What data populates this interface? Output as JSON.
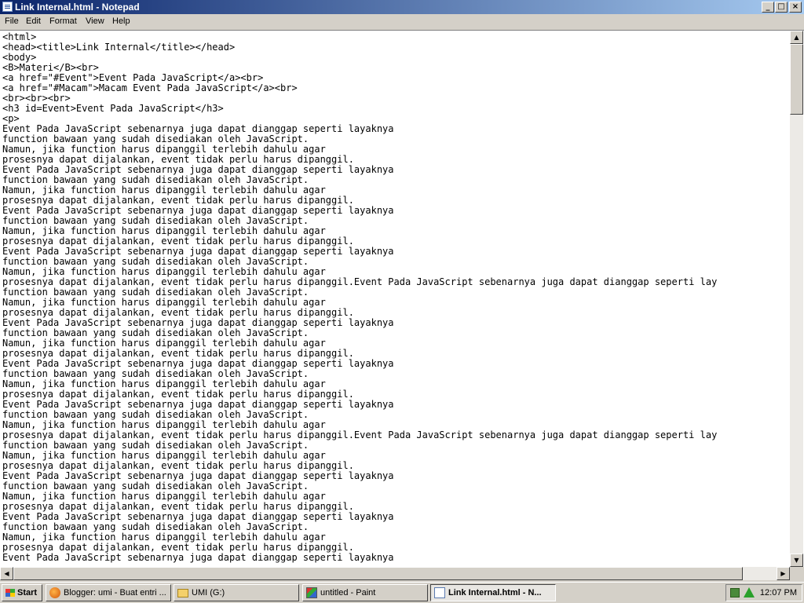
{
  "window": {
    "title": "Link Internal.html - Notepad",
    "controls": {
      "minimize": "_",
      "maximize": "□",
      "close": "×"
    }
  },
  "menu": [
    "File",
    "Edit",
    "Format",
    "View",
    "Help"
  ],
  "editor": {
    "lines": [
      "<html>",
      "<head><title>Link Internal</title></head>",
      "<body>",
      "<B>Materi</B><br>",
      "<a href=\"#Event\">Event Pada JavaScript</a><br>",
      "<a href=\"#Macam\">Macam Event Pada JavaScript</a><br>",
      "<br><br><br>",
      "<h3 id=Event>Event Pada JavaScript</h3>",
      "<p>",
      "Event Pada JavaScript sebenarnya juga dapat dianggap seperti layaknya",
      "function bawaan yang sudah disediakan oleh JavaScript.",
      "Namun, jika function harus dipanggil terlebih dahulu agar",
      "prosesnya dapat dijalankan, event tidak perlu harus dipanggil.",
      "Event Pada JavaScript sebenarnya juga dapat dianggap seperti layaknya",
      "function bawaan yang sudah disediakan oleh JavaScript.",
      "Namun, jika function harus dipanggil terlebih dahulu agar",
      "prosesnya dapat dijalankan, event tidak perlu harus dipanggil.",
      "Event Pada JavaScript sebenarnya juga dapat dianggap seperti layaknya",
      "function bawaan yang sudah disediakan oleh JavaScript.",
      "Namun, jika function harus dipanggil terlebih dahulu agar",
      "prosesnya dapat dijalankan, event tidak perlu harus dipanggil.",
      "Event Pada JavaScript sebenarnya juga dapat dianggap seperti layaknya",
      "function bawaan yang sudah disediakan oleh JavaScript.",
      "Namun, jika function harus dipanggil terlebih dahulu agar",
      "prosesnya dapat dijalankan, event tidak perlu harus dipanggil.Event Pada JavaScript sebenarnya juga dapat dianggap seperti lay",
      "function bawaan yang sudah disediakan oleh JavaScript.",
      "Namun, jika function harus dipanggil terlebih dahulu agar",
      "prosesnya dapat dijalankan, event tidak perlu harus dipanggil.",
      "Event Pada JavaScript sebenarnya juga dapat dianggap seperti layaknya",
      "function bawaan yang sudah disediakan oleh JavaScript.",
      "Namun, jika function harus dipanggil terlebih dahulu agar",
      "prosesnya dapat dijalankan, event tidak perlu harus dipanggil.",
      "Event Pada JavaScript sebenarnya juga dapat dianggap seperti layaknya",
      "function bawaan yang sudah disediakan oleh JavaScript.",
      "Namun, jika function harus dipanggil terlebih dahulu agar",
      "prosesnya dapat dijalankan, event tidak perlu harus dipanggil.",
      "Event Pada JavaScript sebenarnya juga dapat dianggap seperti layaknya",
      "function bawaan yang sudah disediakan oleh JavaScript.",
      "Namun, jika function harus dipanggil terlebih dahulu agar",
      "prosesnya dapat dijalankan, event tidak perlu harus dipanggil.Event Pada JavaScript sebenarnya juga dapat dianggap seperti lay",
      "function bawaan yang sudah disediakan oleh JavaScript.",
      "Namun, jika function harus dipanggil terlebih dahulu agar",
      "prosesnya dapat dijalankan, event tidak perlu harus dipanggil.",
      "Event Pada JavaScript sebenarnya juga dapat dianggap seperti layaknya",
      "function bawaan yang sudah disediakan oleh JavaScript.",
      "Namun, jika function harus dipanggil terlebih dahulu agar",
      "prosesnya dapat dijalankan, event tidak perlu harus dipanggil.",
      "Event Pada JavaScript sebenarnya juga dapat dianggap seperti layaknya",
      "function bawaan yang sudah disediakan oleh JavaScript.",
      "Namun, jika function harus dipanggil terlebih dahulu agar",
      "prosesnya dapat dijalankan, event tidak perlu harus dipanggil.",
      "Event Pada JavaScript sebenarnya juga dapat dianggap seperti layaknya"
    ]
  },
  "scrollbars": {
    "up": "▲",
    "down": "▼",
    "left": "◀",
    "right": "▶"
  },
  "taskbar": {
    "start_label": "Start",
    "tasks": [
      {
        "label": "Blogger: umi - Buat entri ...",
        "icon": "firefox-icon",
        "active": false
      },
      {
        "label": "UMI (G:)",
        "icon": "folder-icon",
        "active": false
      },
      {
        "label": "untitled - Paint",
        "icon": "paint-icon",
        "active": false
      },
      {
        "label": "Link Internal.html - N...",
        "icon": "notepad-icon",
        "active": true
      }
    ],
    "clock": "12:07 PM"
  },
  "colors": {
    "titlebar_start": "#0a246a",
    "titlebar_end": "#a6caf0",
    "chrome": "#d4d0c8"
  }
}
